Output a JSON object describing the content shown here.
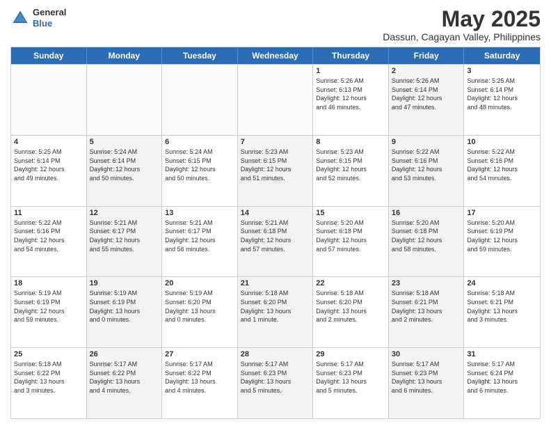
{
  "logo": {
    "general": "General",
    "blue": "Blue"
  },
  "title": "May 2025",
  "subtitle": "Dassun, Cagayan Valley, Philippines",
  "header_days": [
    "Sunday",
    "Monday",
    "Tuesday",
    "Wednesday",
    "Thursday",
    "Friday",
    "Saturday"
  ],
  "weeks": [
    [
      {
        "day": "",
        "info": "",
        "empty": true
      },
      {
        "day": "",
        "info": "",
        "empty": true
      },
      {
        "day": "",
        "info": "",
        "empty": true
      },
      {
        "day": "",
        "info": "",
        "empty": true
      },
      {
        "day": "1",
        "info": "Sunrise: 5:26 AM\nSunset: 6:13 PM\nDaylight: 12 hours\nand 46 minutes.",
        "empty": false
      },
      {
        "day": "2",
        "info": "Sunrise: 5:26 AM\nSunset: 6:14 PM\nDaylight: 12 hours\nand 47 minutes.",
        "empty": false,
        "shaded": true
      },
      {
        "day": "3",
        "info": "Sunrise: 5:25 AM\nSunset: 6:14 PM\nDaylight: 12 hours\nand 48 minutes.",
        "empty": false
      }
    ],
    [
      {
        "day": "4",
        "info": "Sunrise: 5:25 AM\nSunset: 6:14 PM\nDaylight: 12 hours\nand 49 minutes.",
        "empty": false
      },
      {
        "day": "5",
        "info": "Sunrise: 5:24 AM\nSunset: 6:14 PM\nDaylight: 12 hours\nand 50 minutes.",
        "empty": false,
        "shaded": true
      },
      {
        "day": "6",
        "info": "Sunrise: 5:24 AM\nSunset: 6:15 PM\nDaylight: 12 hours\nand 50 minutes.",
        "empty": false
      },
      {
        "day": "7",
        "info": "Sunrise: 5:23 AM\nSunset: 6:15 PM\nDaylight: 12 hours\nand 51 minutes.",
        "empty": false,
        "shaded": true
      },
      {
        "day": "8",
        "info": "Sunrise: 5:23 AM\nSunset: 6:15 PM\nDaylight: 12 hours\nand 52 minutes.",
        "empty": false
      },
      {
        "day": "9",
        "info": "Sunrise: 5:22 AM\nSunset: 6:16 PM\nDaylight: 12 hours\nand 53 minutes.",
        "empty": false,
        "shaded": true
      },
      {
        "day": "10",
        "info": "Sunrise: 5:22 AM\nSunset: 6:16 PM\nDaylight: 12 hours\nand 54 minutes.",
        "empty": false
      }
    ],
    [
      {
        "day": "11",
        "info": "Sunrise: 5:22 AM\nSunset: 6:16 PM\nDaylight: 12 hours\nand 54 minutes.",
        "empty": false
      },
      {
        "day": "12",
        "info": "Sunrise: 5:21 AM\nSunset: 6:17 PM\nDaylight: 12 hours\nand 55 minutes.",
        "empty": false,
        "shaded": true
      },
      {
        "day": "13",
        "info": "Sunrise: 5:21 AM\nSunset: 6:17 PM\nDaylight: 12 hours\nand 56 minutes.",
        "empty": false
      },
      {
        "day": "14",
        "info": "Sunrise: 5:21 AM\nSunset: 6:18 PM\nDaylight: 12 hours\nand 57 minutes.",
        "empty": false,
        "shaded": true
      },
      {
        "day": "15",
        "info": "Sunrise: 5:20 AM\nSunset: 6:18 PM\nDaylight: 12 hours\nand 57 minutes.",
        "empty": false
      },
      {
        "day": "16",
        "info": "Sunrise: 5:20 AM\nSunset: 6:18 PM\nDaylight: 12 hours\nand 58 minutes.",
        "empty": false,
        "shaded": true
      },
      {
        "day": "17",
        "info": "Sunrise: 5:20 AM\nSunset: 6:19 PM\nDaylight: 12 hours\nand 59 minutes.",
        "empty": false
      }
    ],
    [
      {
        "day": "18",
        "info": "Sunrise: 5:19 AM\nSunset: 6:19 PM\nDaylight: 12 hours\nand 59 minutes.",
        "empty": false
      },
      {
        "day": "19",
        "info": "Sunrise: 5:19 AM\nSunset: 6:19 PM\nDaylight: 13 hours\nand 0 minutes.",
        "empty": false,
        "shaded": true
      },
      {
        "day": "20",
        "info": "Sunrise: 5:19 AM\nSunset: 6:20 PM\nDaylight: 13 hours\nand 0 minutes.",
        "empty": false
      },
      {
        "day": "21",
        "info": "Sunrise: 5:18 AM\nSunset: 6:20 PM\nDaylight: 13 hours\nand 1 minute.",
        "empty": false,
        "shaded": true
      },
      {
        "day": "22",
        "info": "Sunrise: 5:18 AM\nSunset: 6:20 PM\nDaylight: 13 hours\nand 2 minutes.",
        "empty": false
      },
      {
        "day": "23",
        "info": "Sunrise: 5:18 AM\nSunset: 6:21 PM\nDaylight: 13 hours\nand 2 minutes.",
        "empty": false,
        "shaded": true
      },
      {
        "day": "24",
        "info": "Sunrise: 5:18 AM\nSunset: 6:21 PM\nDaylight: 13 hours\nand 3 minutes.",
        "empty": false
      }
    ],
    [
      {
        "day": "25",
        "info": "Sunrise: 5:18 AM\nSunset: 6:22 PM\nDaylight: 13 hours\nand 3 minutes.",
        "empty": false
      },
      {
        "day": "26",
        "info": "Sunrise: 5:17 AM\nSunset: 6:22 PM\nDaylight: 13 hours\nand 4 minutes.",
        "empty": false,
        "shaded": true
      },
      {
        "day": "27",
        "info": "Sunrise: 5:17 AM\nSunset: 6:22 PM\nDaylight: 13 hours\nand 4 minutes.",
        "empty": false
      },
      {
        "day": "28",
        "info": "Sunrise: 5:17 AM\nSunset: 6:23 PM\nDaylight: 13 hours\nand 5 minutes.",
        "empty": false,
        "shaded": true
      },
      {
        "day": "29",
        "info": "Sunrise: 5:17 AM\nSunset: 6:23 PM\nDaylight: 13 hours\nand 5 minutes.",
        "empty": false
      },
      {
        "day": "30",
        "info": "Sunrise: 5:17 AM\nSunset: 6:23 PM\nDaylight: 13 hours\nand 6 minutes.",
        "empty": false,
        "shaded": true
      },
      {
        "day": "31",
        "info": "Sunrise: 5:17 AM\nSunset: 6:24 PM\nDaylight: 13 hours\nand 6 minutes.",
        "empty": false
      }
    ]
  ]
}
